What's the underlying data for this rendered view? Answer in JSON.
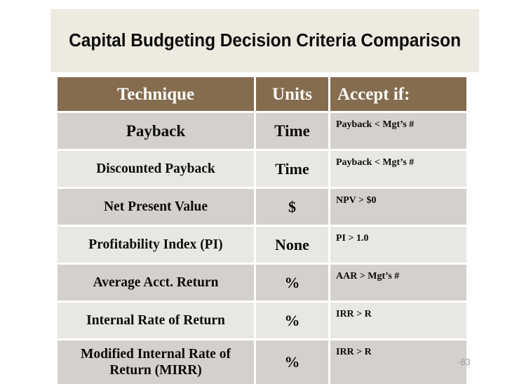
{
  "slide": {
    "title": "Capital Budgeting Decision Criteria Comparison",
    "slide_number": "-83",
    "colors": {
      "title_band_bg": "#EDEAE0",
      "header_bg": "#856C4F",
      "header_text": "#FDFCF8",
      "row_dark_bg": "#D4D0CB",
      "row_light_bg": "#E9E7E3",
      "body_text": "#0B0B0B",
      "slide_number_text": "#9E9E9E",
      "page_bg": "#FFFFFF"
    }
  },
  "table": {
    "headers": [
      "Technique",
      "Units",
      "Accept if:"
    ],
    "rows": [
      {
        "technique": "Payback",
        "units": "Time",
        "accept_if": "Payback < Mgt’s #",
        "shade": "dark"
      },
      {
        "technique": "Discounted Payback",
        "units": "Time",
        "accept_if": "Payback < Mgt’s #",
        "shade": "light"
      },
      {
        "technique": "Net Present Value",
        "units": "$",
        "accept_if": "NPV > $0",
        "shade": "dark"
      },
      {
        "technique": "Profitability Index (PI)",
        "units": "None",
        "accept_if": "PI > 1.0",
        "shade": "light"
      },
      {
        "technique": "Average Acct. Return",
        "units": "%",
        "accept_if": "AAR > Mgt’s #",
        "shade": "dark"
      },
      {
        "technique": "Internal Rate of Return",
        "units": "%",
        "accept_if": "IRR > R",
        "shade": "light"
      },
      {
        "technique": "Modified Internal Rate of Return (MIRR)",
        "units": "%",
        "accept_if": "IRR > R",
        "shade": "dark"
      }
    ]
  }
}
